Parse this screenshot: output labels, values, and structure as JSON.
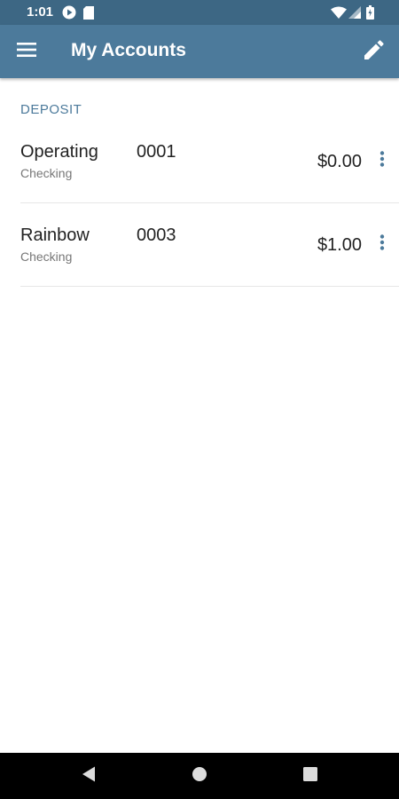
{
  "status_bar": {
    "time": "1:01",
    "icons": [
      "play-circle-icon",
      "sd-card-icon",
      "wifi-icon",
      "signal-icon",
      "battery-icon"
    ]
  },
  "app_bar": {
    "title": "My Accounts",
    "menu_icon": "menu-icon",
    "edit_icon": "edit-pencil-icon"
  },
  "section": {
    "label": "DEPOSIT"
  },
  "accounts": [
    {
      "name": "Operating",
      "type": "Checking",
      "number": "0001",
      "balance": "$0.00"
    },
    {
      "name": "Rainbow",
      "type": "Checking",
      "number": "0003",
      "balance": "$1.00"
    }
  ],
  "nav_bar": {
    "buttons": [
      "back-icon",
      "home-icon",
      "recents-icon"
    ]
  },
  "colors": {
    "status_bar": "#3d6784",
    "app_bar": "#4c7a9b",
    "accent": "#4c7a9b",
    "nav_bar": "#000000"
  }
}
